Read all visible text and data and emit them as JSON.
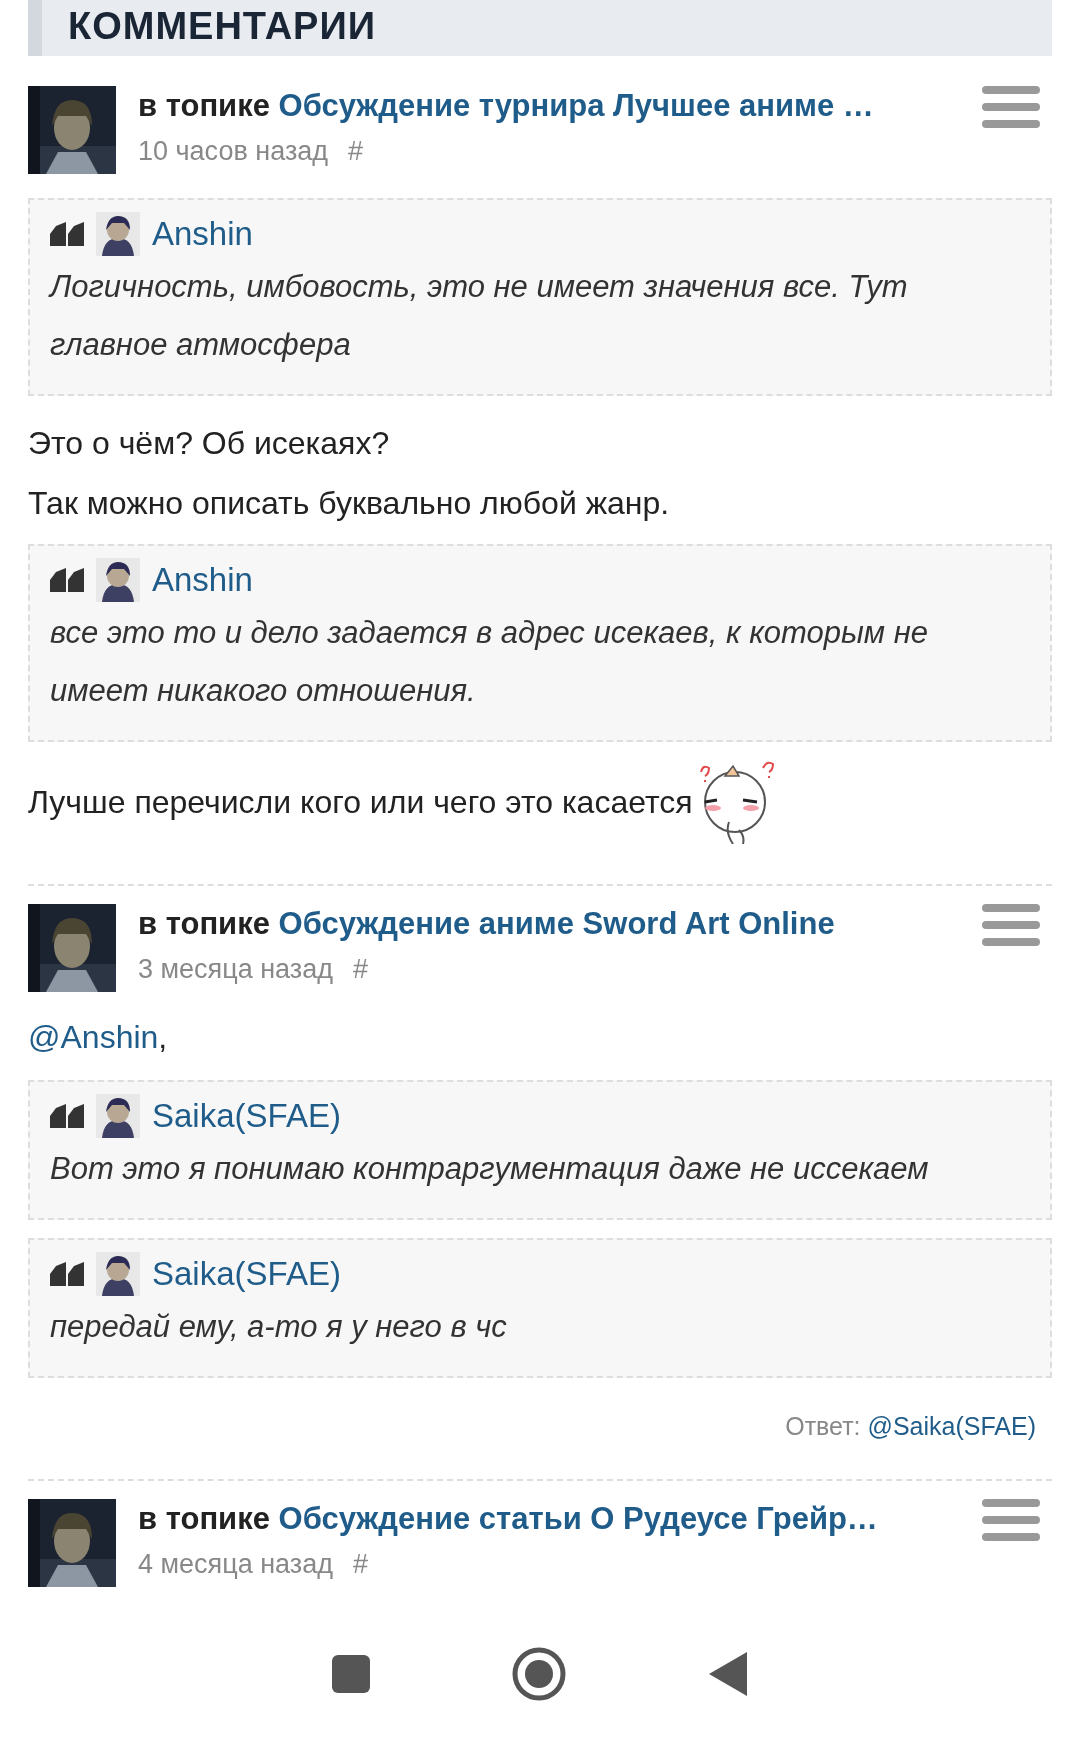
{
  "section_title": "КОММЕНТАРИИ",
  "comments": [
    {
      "prefix": "в топике",
      "topic": "Обсуждение турнира Лучшее аниме …",
      "time": "10 часов назад",
      "hash": "#",
      "body": [
        {
          "kind": "quote",
          "author": "Anshin",
          "text": "Логичность, имбовость, это не имеет значения все. Тут главное атмосфера"
        },
        {
          "kind": "text",
          "text": "Это о чём? Об исекаях?",
          "emoticon": false
        },
        {
          "kind": "text",
          "text": "Так можно описать буквально любой жанр.",
          "emoticon": false
        },
        {
          "kind": "quote",
          "author": "Anshin",
          "text": "все это то и дело задается в адрес исекаев, к которым не имеет никакого отношения."
        },
        {
          "kind": "text",
          "text": "Лучше перечисли кого или чего это касается",
          "emoticon": true
        }
      ]
    },
    {
      "prefix": "в топике",
      "topic": "Обсуждение аниме Sword Art Online",
      "time": "3 месяца назад",
      "hash": "#",
      "body": [
        {
          "kind": "mention",
          "text": "@Anshin",
          "suffix": ","
        },
        {
          "kind": "quote",
          "author": "Saika(SFAE)",
          "text": "Вот это я понимаю контраргументация даже не иссекаем"
        },
        {
          "kind": "quote",
          "author": "Saika(SFAE)",
          "text": "передай ему, а-то я у него в чс"
        }
      ],
      "reply": {
        "label": "Ответ:",
        "user": "@Saika(SFAE)"
      }
    },
    {
      "prefix": "в топике",
      "topic": "Обсуждение статьи О Рудеусе Грейр…",
      "time": "4 месяца назад",
      "hash": "#"
    }
  ]
}
